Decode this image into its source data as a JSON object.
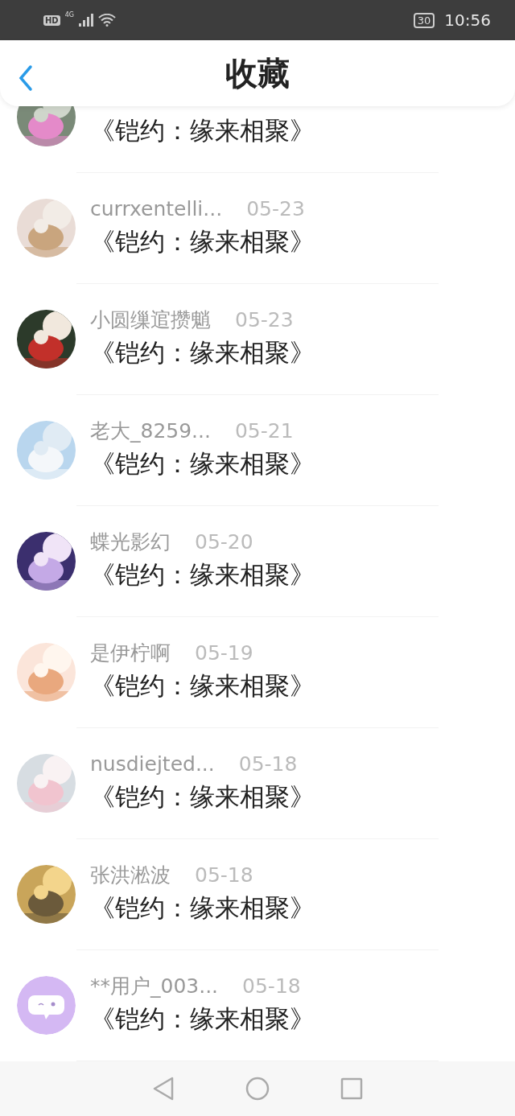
{
  "status_bar": {
    "hd": "HD",
    "network": "4G",
    "battery": "30",
    "time": "10:56"
  },
  "header": {
    "title": "收藏"
  },
  "items": [
    {
      "kind": "picture",
      "title": "《铠约：缘来相聚》"
    },
    {
      "kind": "picture",
      "name": "currxentelli...",
      "date": "05-23",
      "title": "《铠约：缘来相聚》"
    },
    {
      "kind": "picture",
      "name": "小圆缫逭攒魈",
      "date": "05-23",
      "title": "《铠约：缘来相聚》"
    },
    {
      "kind": "picture",
      "name": "老大_8259...",
      "date": "05-21",
      "title": "《铠约：缘来相聚》"
    },
    {
      "kind": "picture",
      "name": "蝶光影幻",
      "date": "05-20",
      "title": "《铠约：缘来相聚》"
    },
    {
      "kind": "picture",
      "name": "是伊柠啊",
      "date": "05-19",
      "title": "《铠约：缘来相聚》"
    },
    {
      "kind": "picture",
      "name": "nusdiejted...",
      "date": "05-18",
      "title": "《铠约：缘来相聚》"
    },
    {
      "kind": "picture",
      "name": "张洪淞波",
      "date": "05-18",
      "title": "《铠约：缘来相聚》"
    },
    {
      "kind": "default",
      "name": "**用户_003...",
      "date": "05-18",
      "title": "《铠约：缘来相聚》"
    }
  ]
}
